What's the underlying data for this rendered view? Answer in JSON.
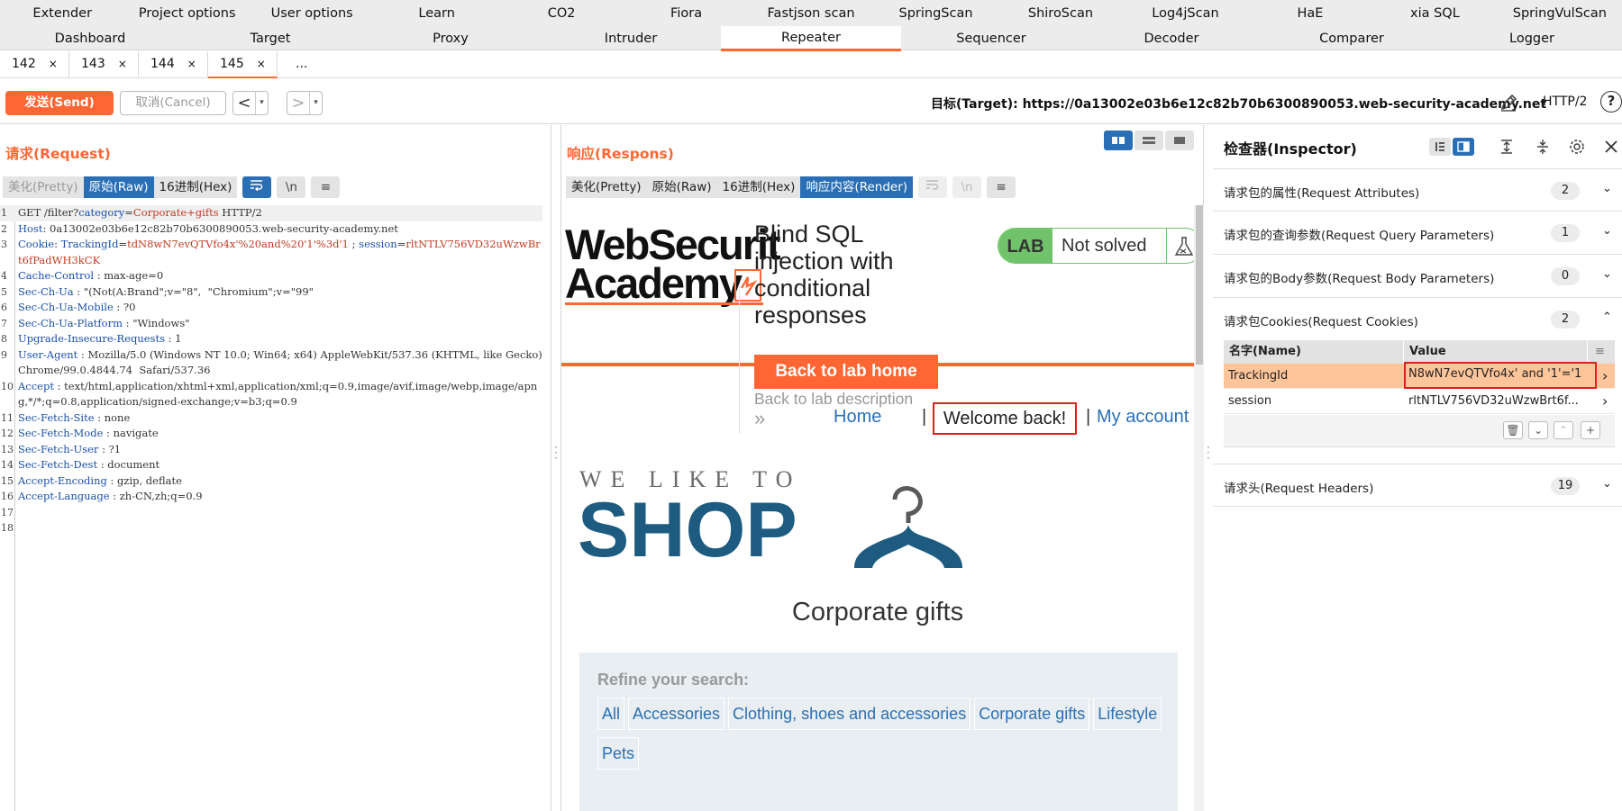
{
  "top_tabs_row1": [
    "Extender",
    "Project options",
    "User options",
    "Learn",
    "CO2",
    "Fiora",
    "Fastjson scan",
    "SpringScan",
    "ShiroScan",
    "Log4jScan",
    "HaE",
    "xia SQL",
    "SpringVulScan"
  ],
  "top_tabs_row2": [
    "Dashboard",
    "Target",
    "Proxy",
    "Intruder",
    "Repeater",
    "Sequencer",
    "Decoder",
    "Comparer",
    "Logger"
  ],
  "active_top_tab": "Repeater",
  "repeater_tabs": [
    {
      "label": "142",
      "close": "×"
    },
    {
      "label": "143",
      "close": "×"
    },
    {
      "label": "144",
      "close": "×"
    },
    {
      "label": "145",
      "close": "×"
    }
  ],
  "repeater_more": "...",
  "toolbar": {
    "send_label": "发送(Send)",
    "cancel_label": "取消(Cancel)",
    "back_arrow": "<",
    "forward_arrow": ">",
    "dropdown": "▾",
    "target_text": "目标(Target): https://0a13002e03b6e12c82b70b6300890053.web-security-academy.net",
    "http_version": "HTTP/2",
    "help": "?"
  },
  "request": {
    "title": "请求(Request)",
    "view_tabs": [
      "美化(Pretty)",
      "原始(Raw)",
      "16进制(Hex)"
    ],
    "icon_labels": [
      "\\n"
    ],
    "lines": [
      {
        "n": "1",
        "parts": [
          [
            "hv",
            "GET /filter?"
          ],
          [
            "pn",
            "category"
          ],
          [
            "hv",
            "="
          ],
          [
            "cv",
            "Corporate+gifts"
          ],
          [
            "hv",
            " HTTP/2"
          ]
        ]
      },
      {
        "n": "2",
        "parts": [
          [
            "hn",
            "Host"
          ],
          [
            "hv",
            ": 0a13002e03b6e12c82b70b6300890053.web-security-academy.net"
          ]
        ]
      },
      {
        "n": "3",
        "parts": [
          [
            "hn",
            "Cookie"
          ],
          [
            "hv",
            ": "
          ],
          [
            "hn",
            "TrackingId"
          ],
          [
            "hv",
            "="
          ],
          [
            "cv",
            "tdN8wN7evQTVfo4x'%20and%20'1'%3d'1"
          ],
          [
            "hv",
            " ; "
          ],
          [
            "hn",
            "session"
          ],
          [
            "hv",
            "="
          ],
          [
            "cv",
            "rltNTLV756VD32uWzwBrt6fPadWH3kCK"
          ]
        ]
      },
      {
        "n": "4",
        "parts": [
          [
            "hn",
            "Cache-Control"
          ],
          [
            "hv",
            " : max-age=0"
          ]
        ]
      },
      {
        "n": "5",
        "parts": [
          [
            "hn",
            "Sec-Ch-Ua"
          ],
          [
            "hv",
            " : \"(Not(A:Brand\";v=\"8\",  \"Chromium\";v=\"99\""
          ]
        ]
      },
      {
        "n": "6",
        "parts": [
          [
            "hn",
            "Sec-Ch-Ua-Mobile"
          ],
          [
            "hv",
            " : ?0"
          ]
        ]
      },
      {
        "n": "7",
        "parts": [
          [
            "hn",
            "Sec-Ch-Ua-Platform"
          ],
          [
            "hv",
            " : \"Windows\""
          ]
        ]
      },
      {
        "n": "8",
        "parts": [
          [
            "hn",
            "Upgrade-Insecure-Requests"
          ],
          [
            "hv",
            " : 1"
          ]
        ]
      },
      {
        "n": "9",
        "parts": [
          [
            "hn",
            "User-Agent"
          ],
          [
            "hv",
            " : Mozilla/5.0 (Windows NT 10.0; Win64; x64) AppleWebKit/537.36 (KHTML, like Gecko) Chrome/99.0.4844.74  Safari/537.36"
          ]
        ]
      },
      {
        "n": "10",
        "parts": [
          [
            "hn",
            "Accept"
          ],
          [
            "hv",
            " : text/html,application/xhtml+xml,application/xml;q=0.9,image/avif,image/webp,image/apng,*/*;q=0.8,application/signed-exchange;v=b3;q=0.9"
          ]
        ]
      },
      {
        "n": "11",
        "parts": [
          [
            "hn",
            "Sec-Fetch-Site"
          ],
          [
            "hv",
            " : none"
          ]
        ]
      },
      {
        "n": "12",
        "parts": [
          [
            "hn",
            "Sec-Fetch-Mode"
          ],
          [
            "hv",
            " : navigate"
          ]
        ]
      },
      {
        "n": "13",
        "parts": [
          [
            "hn",
            "Sec-Fetch-User"
          ],
          [
            "hv",
            " : ?1"
          ]
        ]
      },
      {
        "n": "14",
        "parts": [
          [
            "hn",
            "Sec-Fetch-Dest"
          ],
          [
            "hv",
            " : document"
          ]
        ]
      },
      {
        "n": "15",
        "parts": [
          [
            "hn",
            "Accept-Encoding"
          ],
          [
            "hv",
            " : gzip, deflate"
          ]
        ]
      },
      {
        "n": "16",
        "parts": [
          [
            "hn",
            "Accept-Language"
          ],
          [
            "hv",
            " : zh-CN,zh;q=0.9"
          ]
        ]
      },
      {
        "n": "17",
        "parts": []
      },
      {
        "n": "18",
        "parts": []
      }
    ]
  },
  "response": {
    "title": "响应(Respons)",
    "view_tabs": [
      "美化(Pretty)",
      "原始(Raw)",
      "16进制(Hex)",
      "响应内容(Render)"
    ],
    "icon_labels": [
      "\\n"
    ],
    "render": {
      "logo_line1": "WebSecurit",
      "logo_line2": "Academy",
      "lab_title": "Blind SQL injection with conditional responses",
      "lab_badge": "LAB",
      "lab_status": "Not solved",
      "back_home": "Back to lab home",
      "back_desc": "Back to lab description",
      "desc_arrows": "»",
      "nav_home": "Home",
      "nav_sep": "|",
      "welcome": "Welcome back!",
      "nav_account": "My account",
      "shop_tagline": "WE LIKE TO",
      "shop_word": "SHOP",
      "category_heading": "Corporate gifts",
      "refine_label": "Refine your search:",
      "filters": [
        "All",
        "Accessories",
        "Clothing, shoes and accessories",
        "Corporate gifts",
        "Lifestyle",
        "Pets"
      ]
    }
  },
  "inspector": {
    "title": "检查器(Inspector)",
    "sections": [
      {
        "label": "请求包的属性(Request Attributes)",
        "count": "2",
        "chev": "⌄"
      },
      {
        "label": "请求包的查询参数(Request Query Parameters)",
        "count": "1",
        "chev": "⌄"
      },
      {
        "label": "请求包的Body参数(Request Body Parameters)",
        "count": "0",
        "chev": "⌄"
      },
      {
        "label": "请求包Cookies(Request Cookies)",
        "count": "2",
        "chev": "⌃"
      },
      {
        "label": "请求头(Request Headers)",
        "count": "19",
        "chev": "⌄"
      }
    ],
    "cookie_table": {
      "col_name": "名字(Name)",
      "col_value": "Value",
      "rows": [
        {
          "name": "TrackingId",
          "value": "N8wN7evQTVfo4x' and '1'='1",
          "arrow": "›"
        },
        {
          "name": "session",
          "value": "rltNTLV756VD32uWzwBrt6f...",
          "arrow": "›"
        }
      ]
    }
  },
  "colors": {
    "accent": "#ff6633",
    "blue": "#2a6fb5",
    "highlight_red": "#e0201b",
    "shop_blue": "#1d5b80",
    "lab_green": "#70c36a"
  }
}
